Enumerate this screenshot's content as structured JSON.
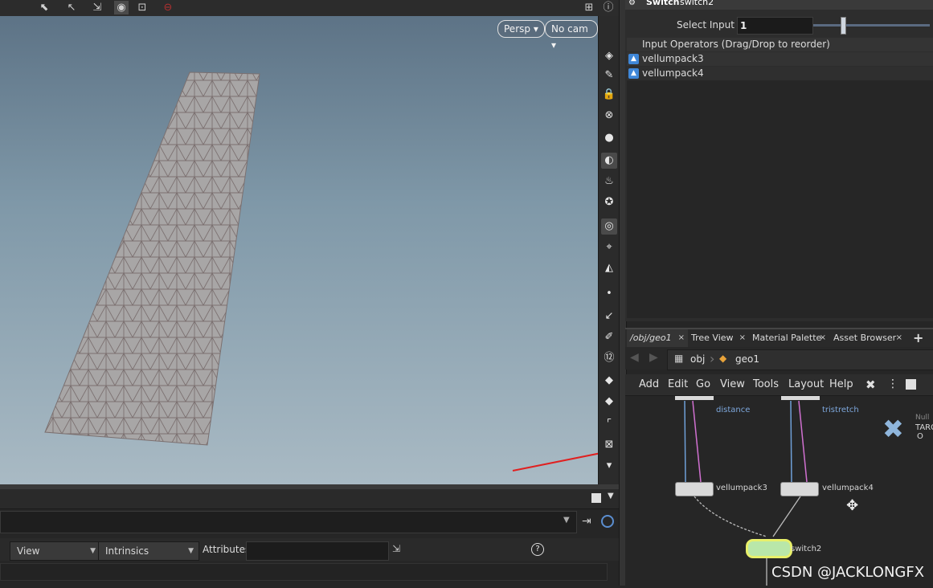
{
  "viewport": {
    "persp_label": "Persp",
    "cam_label": "No cam"
  },
  "attr_spreadsheet": {
    "view_label": "View",
    "intrinsics_label": "Intrinsics",
    "attributes_label": "Attributes:",
    "help_glyph": "?"
  },
  "param_panel": {
    "node_type": "Switch",
    "node_name": "switch2",
    "select_input_label": "Select Input",
    "select_input_value": "1",
    "input_ops_header": "Input Operators (Drag/Drop to reorder)",
    "input_ops": [
      "vellumpack3",
      "vellumpack4"
    ]
  },
  "network": {
    "tabs": [
      {
        "label": "/obj/geo1",
        "close": "×"
      },
      {
        "label": "Tree View",
        "close": "×"
      },
      {
        "label": "Material Palette",
        "close": "×"
      },
      {
        "label": "Asset Browser",
        "close": "×"
      }
    ],
    "add_tab": "+",
    "path": [
      "obj",
      "geo1"
    ],
    "menu": [
      "Add",
      "Edit",
      "Go",
      "View",
      "Tools",
      "Layout",
      "Help"
    ],
    "nodes": {
      "distance_label": "distance",
      "tristretch_label": "tristretch",
      "vellumpack3_label": "vellumpack3",
      "vellumpack4_label": "vellumpack4",
      "switch_label": "switch2",
      "null_type": "Null",
      "null_name": "TARG",
      "null_sub": "O"
    }
  },
  "watermark": "CSDN @JACKLONGFX",
  "colors": {
    "accent_red": "#e02020",
    "switch_node": "#e8f06a",
    "wire_blue": "#6fa0d8",
    "wire_pink": "#d070d0"
  }
}
